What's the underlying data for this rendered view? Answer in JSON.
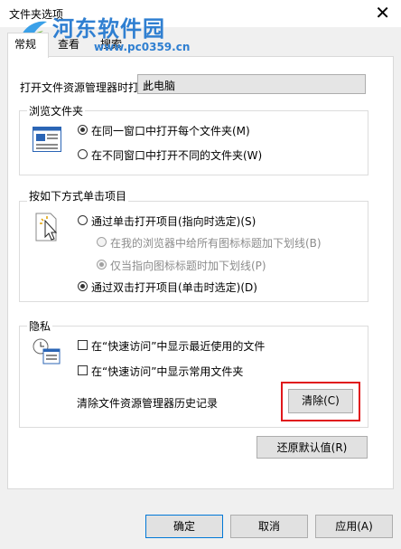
{
  "window": {
    "title": "文件夹选项",
    "close": "✕"
  },
  "watermark": {
    "text": "河东软件园",
    "url": "www.pc0359.cn"
  },
  "tabs": [
    {
      "label": "常规",
      "active": true
    },
    {
      "label": "查看",
      "active": false
    },
    {
      "label": "搜索",
      "active": false
    }
  ],
  "open_explorer": {
    "label": "打开文件资源管理器时打",
    "value": "此电脑"
  },
  "browse": {
    "title": "浏览文件夹",
    "options": [
      {
        "label": "在同一窗口中打开每个文件夹(M)",
        "checked": true
      },
      {
        "label": "在不同窗口中打开不同的文件夹(W)",
        "checked": false
      }
    ]
  },
  "click": {
    "title": "按如下方式单击项目",
    "single": "通过单击打开项目(指向时选定)(S)",
    "sub1": "在我的浏览器中给所有图标标题加下划线(B)",
    "sub2": "仅当指向图标标题时加下划线(P)",
    "double": "通过双击打开项目(单击时选定)(D)"
  },
  "privacy": {
    "title": "隐私",
    "recent": "在“快速访问”中显示最近使用的文件",
    "frequent": "在“快速访问”中显示常用文件夹",
    "clear_label": "清除文件资源管理器历史记录",
    "clear_button": "清除(C)"
  },
  "restore_button": "还原默认值(R)",
  "footer": {
    "ok": "确定",
    "cancel": "取消",
    "apply": "应用(A)"
  },
  "colors": {
    "highlight": "#e0171b",
    "watermark": "#2f7fd1",
    "accent": "#0078d7"
  }
}
